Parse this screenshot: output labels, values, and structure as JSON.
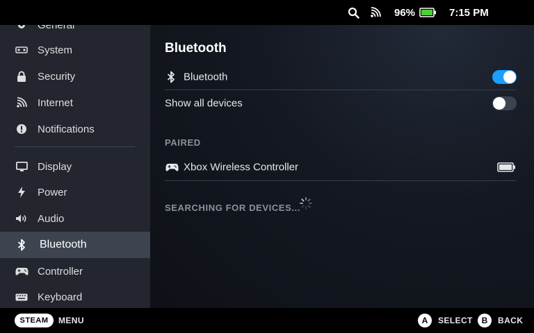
{
  "status_bar": {
    "battery_percent": "96%",
    "time": "7:15 PM",
    "icons": [
      "search-icon",
      "wifi-icon",
      "battery-icon"
    ]
  },
  "sidebar": {
    "items": [
      {
        "label": "General",
        "icon": "gear-icon"
      },
      {
        "label": "System",
        "icon": "system-icon"
      },
      {
        "label": "Security",
        "icon": "lock-icon"
      },
      {
        "label": "Internet",
        "icon": "wifi-icon"
      },
      {
        "label": "Notifications",
        "icon": "alert-icon"
      },
      {
        "label": "Display",
        "icon": "monitor-icon"
      },
      {
        "label": "Power",
        "icon": "bolt-icon"
      },
      {
        "label": "Audio",
        "icon": "speaker-icon"
      },
      {
        "label": "Bluetooth",
        "icon": "bluetooth-icon",
        "active": true
      },
      {
        "label": "Controller",
        "icon": "gamepad-icon"
      },
      {
        "label": "Keyboard",
        "icon": "keyboard-icon"
      }
    ]
  },
  "main": {
    "title": "Bluetooth",
    "bluetooth_toggle": {
      "label": "Bluetooth",
      "on": true
    },
    "show_all_toggle": {
      "label": "Show all devices",
      "on": false
    },
    "paired_header": "PAIRED",
    "paired_devices": [
      {
        "name": "Xbox Wireless Controller",
        "icon": "gamepad-icon",
        "battery": "full"
      }
    ],
    "searching_label": "SEARCHING FOR DEVICES..."
  },
  "bottom_bar": {
    "steam_label": "STEAM",
    "menu_label": "MENU",
    "a_glyph": "A",
    "select_label": "SELECT",
    "b_glyph": "B",
    "back_label": "BACK"
  },
  "colors": {
    "accent": "#1a9fff",
    "sidebar_bg": "#23262e",
    "sidebar_active": "#3d4450"
  }
}
